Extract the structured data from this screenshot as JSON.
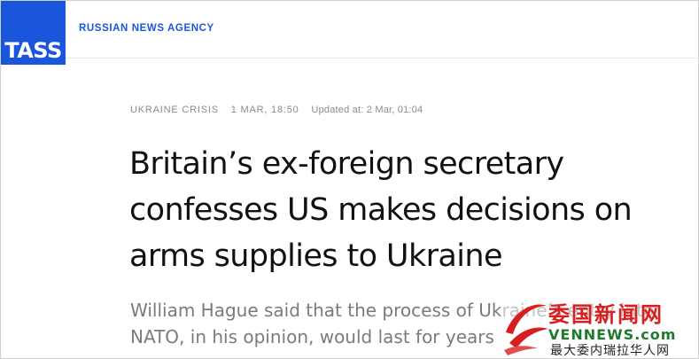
{
  "header": {
    "logo_text": "TASS",
    "agency_name": "RUSSIAN NEWS AGENCY"
  },
  "article": {
    "category": "UKRAINE CRISIS",
    "published": "1 MAR, 18:50",
    "updated": "Updated at: 2 Mar, 01:04",
    "headline": "Britain’s ex-foreign secretary confesses US makes decisions on arms supplies to Ukraine",
    "lead": "William Hague said that the process of Ukraine’s entry into NATO, in his opinion, would last for years"
  },
  "watermark": {
    "chinese_title": "委国新闻网",
    "english": "VENNEWS.com",
    "subtitle": "最大委内瑞拉华人网"
  },
  "colors": {
    "brand_blue": "#1a56db",
    "text_dark": "#111111",
    "text_gray": "#7b7b7b",
    "watermark_red": "#d81e1e",
    "watermark_green": "#1f7a2e"
  }
}
